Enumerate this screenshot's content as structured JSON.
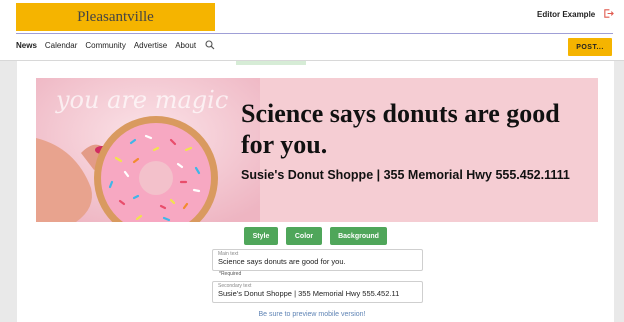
{
  "header": {
    "logo_text": "Pleasantville",
    "editor_name": "Editor Example",
    "logout_icon": "logout-icon",
    "nav_items": [
      "News",
      "Calendar",
      "Community",
      "Advertise",
      "About"
    ],
    "search_icon": "search-icon",
    "post_label": "POST..."
  },
  "ad": {
    "headline": "Science says donuts are good for you.",
    "secondary": "Susie's Donut Shoppe | 355 Memorial Hwy 555.452.1111",
    "photo_neon_text": "you are magic"
  },
  "editor": {
    "buttons": [
      "Style",
      "Color",
      "Background"
    ],
    "main_text": {
      "label": "Main text",
      "value": "Science says donuts are good for you."
    },
    "required_note": "*Required",
    "secondary_text": {
      "label": "Secondary text",
      "value": "Susie's Donut Shoppe | 355 Memorial Hwy   555.452.11"
    },
    "hint": "Be sure to preview mobile version!"
  },
  "colors": {
    "brand_yellow": "#f5b400",
    "button_green": "#4fa65a",
    "ad_background": "#f5cdd3",
    "hint_blue": "#5f84b5"
  }
}
